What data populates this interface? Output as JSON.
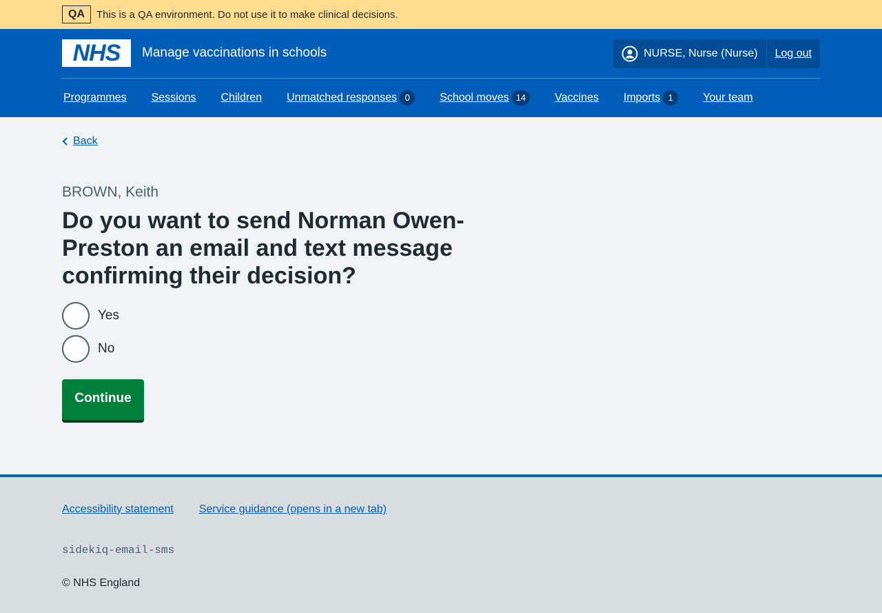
{
  "qa_banner": {
    "tag": "QA",
    "message": "This is a QA environment. Do not use it to make clinical decisions."
  },
  "header": {
    "logo_text": "NHS",
    "service_name": "Manage vaccinations in schools",
    "account": {
      "user": "NURSE, Nurse (Nurse)",
      "logout": "Log out"
    }
  },
  "nav": {
    "items": [
      {
        "label": "Programmes"
      },
      {
        "label": "Sessions"
      },
      {
        "label": "Children"
      },
      {
        "label": "Unmatched responses",
        "count": "0"
      },
      {
        "label": "School moves",
        "count": "14"
      },
      {
        "label": "Vaccines"
      },
      {
        "label": "Imports",
        "count": "1"
      },
      {
        "label": "Your team"
      }
    ]
  },
  "main": {
    "back": "Back",
    "caption": "BROWN, Keith",
    "question": "Do you want to send Norman Owen-Preston an email and text message confirming their decision?",
    "options": [
      "Yes",
      "No"
    ],
    "continue": "Continue"
  },
  "footer": {
    "links": [
      "Accessibility statement",
      "Service guidance (opens in a new tab)"
    ],
    "env": "sidekiq-email-sms",
    "copyright": "© NHS England"
  },
  "colors": {
    "nhs_blue": "#005eb8",
    "qa_yellow": "#ffdc8e",
    "button_green": "#007f3b",
    "page_bg": "#f0f4f5",
    "footer_bg": "#d8dde0"
  }
}
